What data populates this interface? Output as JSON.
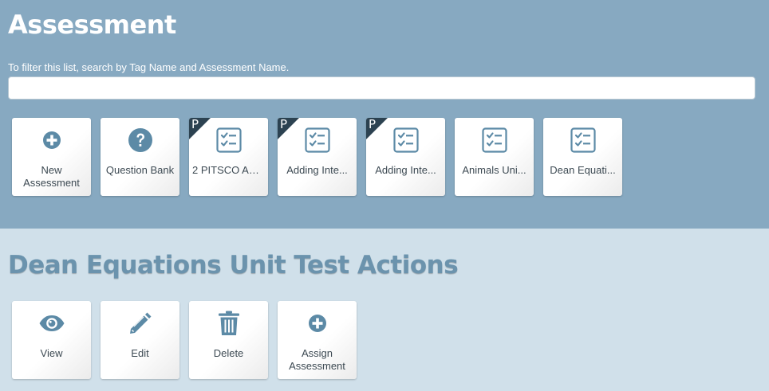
{
  "header": {
    "title": "Assessment",
    "filter_hint": "To filter this list, search by Tag Name and Assessment Name.",
    "search_value": ""
  },
  "tiles": [
    {
      "label": "New Assessment",
      "icon": "plus-circle-icon",
      "badge": ""
    },
    {
      "label": "Question Bank",
      "icon": "question-circle-icon",
      "badge": ""
    },
    {
      "label": "2 PITSCO AD...",
      "icon": "checklist-icon",
      "badge": "P"
    },
    {
      "label": "Adding Inte...",
      "icon": "checklist-icon",
      "badge": "P"
    },
    {
      "label": "Adding Inte...",
      "icon": "checklist-icon",
      "badge": "P"
    },
    {
      "label": "Animals Uni...",
      "icon": "checklist-icon",
      "badge": ""
    },
    {
      "label": "Dean Equati...",
      "icon": "checklist-icon",
      "badge": ""
    }
  ],
  "actions": {
    "title": "Dean Equations Unit Test Actions",
    "items": [
      {
        "label": "View",
        "icon": "eye-icon"
      },
      {
        "label": "Edit",
        "icon": "pencil-icon"
      },
      {
        "label": "Delete",
        "icon": "trash-icon"
      },
      {
        "label": "Assign Assessment",
        "icon": "plus-circle-icon"
      }
    ]
  },
  "colors": {
    "header_bg": "#87a9c1",
    "body_bg": "#d0e0ea",
    "icon": "#5c8aa6",
    "badge": "#2c4251",
    "label_text": "#3d4a53",
    "actions_title": "#6b93ad"
  }
}
